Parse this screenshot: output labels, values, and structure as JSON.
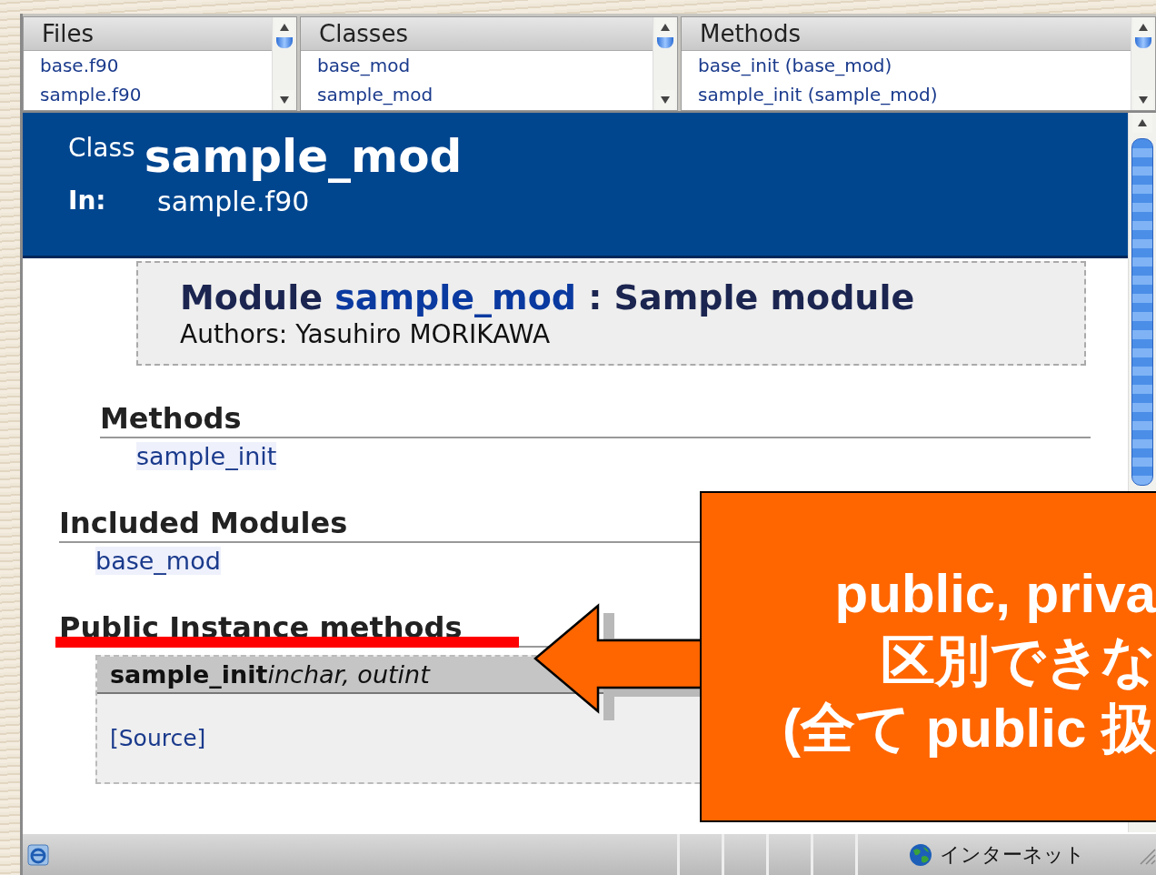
{
  "frames": [
    {
      "title": "Files",
      "items": [
        "base.f90",
        "sample.f90"
      ]
    },
    {
      "title": "Classes",
      "items": [
        "base_mod",
        "sample_mod"
      ]
    },
    {
      "title": "Methods",
      "items": [
        "base_init (base_mod)",
        "sample_init (sample_mod)"
      ]
    }
  ],
  "header": {
    "label": "Class",
    "name": "sample_mod",
    "in_label": "In:",
    "in_value": "sample.f90"
  },
  "description": {
    "title_prefix": "Module",
    "title_name": "sample_mod",
    "title_suffix": ": Sample module",
    "authors": "Authors: Yasuhiro MORIKAWA"
  },
  "sections": [
    {
      "kind": "list",
      "title": "Methods",
      "indented": true,
      "highlighted": false,
      "links": [
        "sample_init"
      ]
    },
    {
      "kind": "list",
      "title": "Included Modules",
      "indented": false,
      "highlighted": false,
      "links": [
        "base_mod"
      ]
    },
    {
      "kind": "methods",
      "title": "Public Instance methods",
      "indented": false,
      "highlighted": true,
      "method": {
        "name": "sample_init",
        "params": "inchar, outint",
        "source": "[Source]"
      }
    }
  ],
  "status_bar": {
    "zone": "インターネット"
  },
  "callout": {
    "lines": [
      "public, priva",
      "区別できな",
      "(全て public 扱"
    ]
  }
}
